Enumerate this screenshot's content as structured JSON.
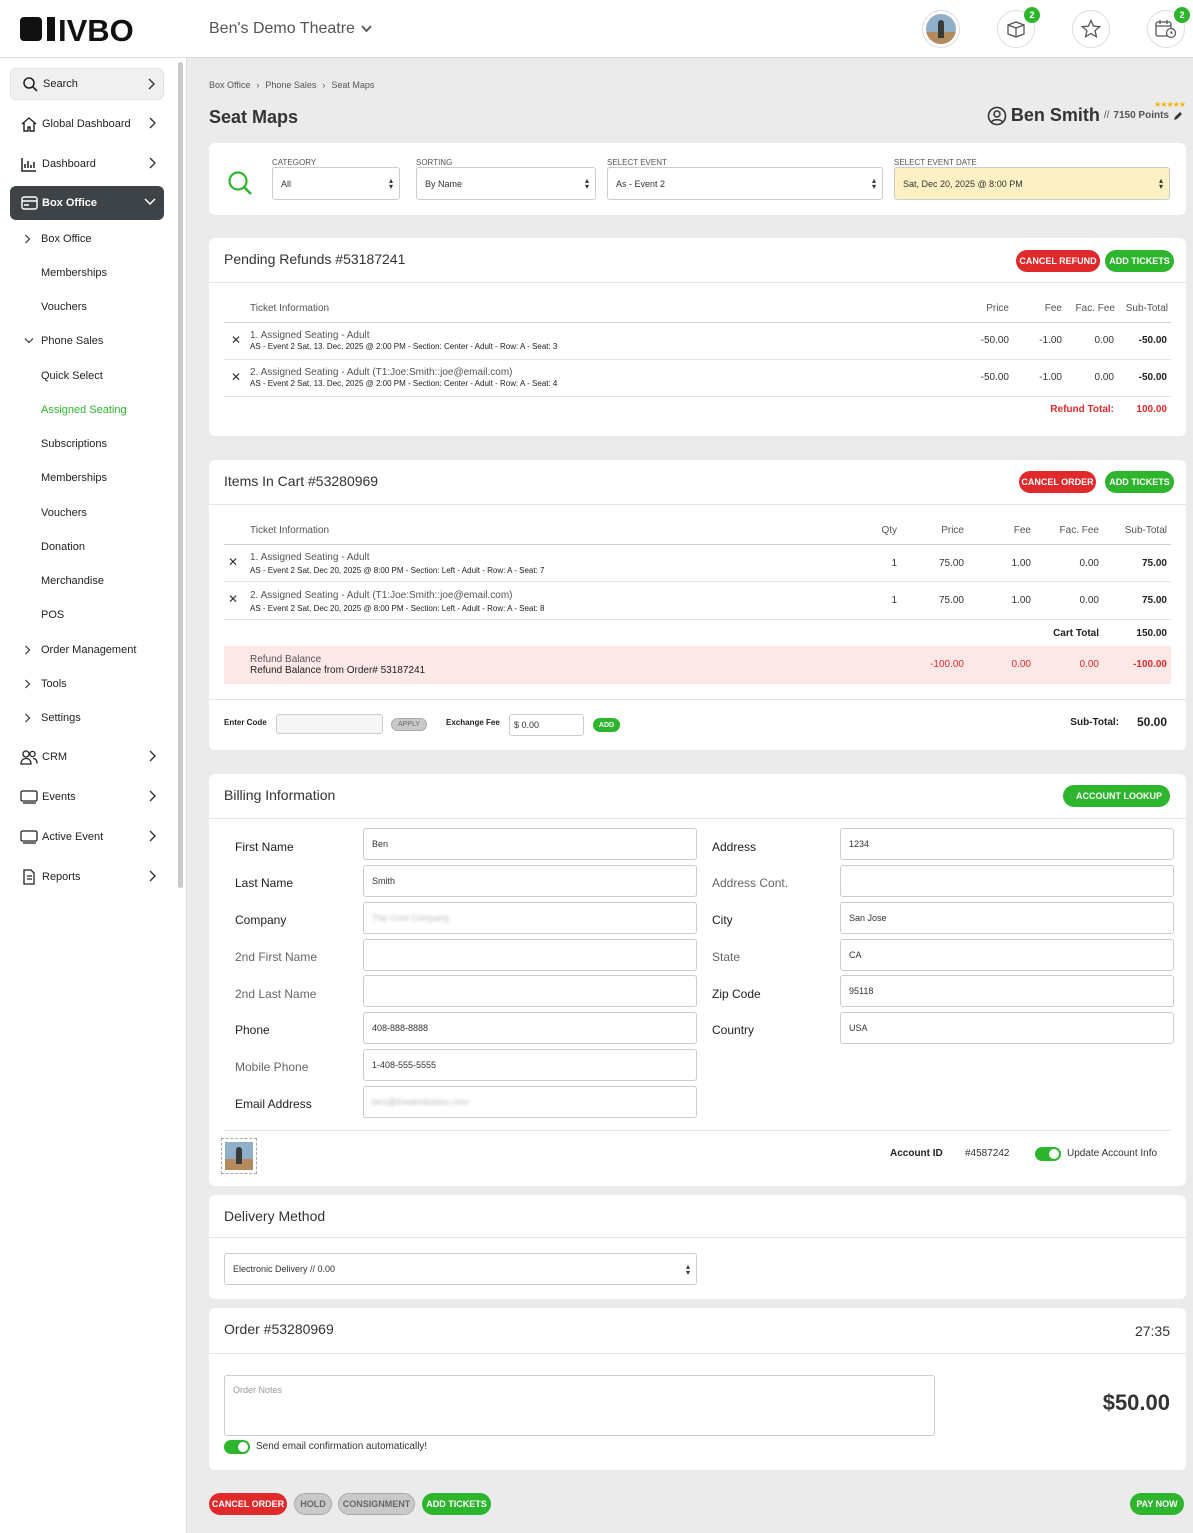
{
  "header": {
    "logo": "IVBO",
    "theatre": "Ben's Demo Theatre",
    "cart_badge": "2",
    "calendar_badge": "2",
    "icons": [
      "avatar",
      "box-icon",
      "star-icon",
      "calendar-icon"
    ]
  },
  "sidebar": {
    "main_items": [
      {
        "label": "Search",
        "icon": "search-icon"
      },
      {
        "label": "Global Dashboard",
        "icon": "home-icon"
      },
      {
        "label": "Dashboard",
        "icon": "chart-icon"
      },
      {
        "label": "Box Office",
        "icon": "card-icon"
      }
    ],
    "sub_items": [
      {
        "label": "Box Office"
      },
      {
        "label": "Memberships"
      },
      {
        "label": "Vouchers"
      },
      {
        "label": "Phone Sales"
      },
      {
        "label": "Quick Select"
      },
      {
        "label": "Assigned Seating"
      },
      {
        "label": "Subscriptions"
      },
      {
        "label": "Memberships"
      },
      {
        "label": "Vouchers"
      },
      {
        "label": "Donation"
      },
      {
        "label": "Merchandise"
      },
      {
        "label": "POS"
      },
      {
        "label": "Order Management"
      },
      {
        "label": "Tools"
      },
      {
        "label": "Settings"
      }
    ],
    "bottom_items": [
      {
        "label": "CRM",
        "icon": "people-icon"
      },
      {
        "label": "Events",
        "icon": "ticket-icon"
      },
      {
        "label": "Active Event",
        "icon": "ticket-icon"
      },
      {
        "label": "Reports",
        "icon": "document-icon"
      }
    ]
  },
  "breadcrumb": [
    "Box Office",
    "Phone Sales",
    "Seat Maps"
  ],
  "page_title": "Seat Maps",
  "user": {
    "name": "Ben Smith",
    "sep": "//",
    "points": "7150 Points",
    "stars": "★★★★★"
  },
  "filters": {
    "category_label": "CATEGORY",
    "category": "All",
    "sorting_label": "SORTING",
    "sorting": "By Name",
    "event_label": "SELECT EVENT",
    "event": "As - Event 2",
    "date_label": "SELECT EVENT DATE",
    "date": "Sat, Dec 20, 2025 @ 8:00 PM"
  },
  "refunds": {
    "title": "Pending Refunds #53187241",
    "cancel_btn": "CANCEL REFUND",
    "add_btn": "ADD TICKETS",
    "headers": {
      "info": "Ticket Information",
      "price": "Price",
      "fee": "Fee",
      "fac": "Fac. Fee",
      "sub": "Sub-Total"
    },
    "rows": [
      {
        "num": "1.",
        "title": "Assigned Seating - Adult",
        "desc": "AS - Event 2 Sat, 13. Dec, 2025 @ 2:00 PM - Section: Center - Adult - Row: A - Seat: 3",
        "price": "-50.00",
        "fee": "-1.00",
        "fac": "0.00",
        "sub": "-50.00"
      },
      {
        "num": "2.",
        "title": "Assigned Seating - Adult (T1:Joe:Smith::joe@email.com)",
        "desc": "AS - Event 2 Sat, 13. Dec, 2025 @ 2:00 PM - Section: Center - Adult - Row: A - Seat: 4",
        "price": "-50.00",
        "fee": "-1.00",
        "fac": "0.00",
        "sub": "-50.00"
      }
    ],
    "total_label": "Refund Total:",
    "total": "100.00"
  },
  "cart": {
    "title": "Items In Cart #53280969",
    "cancel_btn": "CANCEL ORDER",
    "add_btn": "ADD TICKETS",
    "headers": {
      "info": "Ticket Information",
      "qty": "Qty",
      "price": "Price",
      "fee": "Fee",
      "fac": "Fac. Fee",
      "sub": "Sub-Total"
    },
    "rows": [
      {
        "num": "1.",
        "title": "Assigned Seating - Adult",
        "desc": "AS - Event 2 Sat, Dec 20, 2025 @ 8:00 PM - Section: Left - Adult - Row: A - Seat: 7",
        "qty": "1",
        "price": "75.00",
        "fee": "1.00",
        "fac": "0.00",
        "sub": "75.00"
      },
      {
        "num": "2.",
        "title": "Assigned Seating - Adult (T1:Joe:Smith::joe@email.com)",
        "desc": "AS - Event 2 Sat, Dec 20, 2025 @ 8:00 PM - Section: Left - Adult - Row: A - Seat: 8",
        "qty": "1",
        "price": "75.00",
        "fee": "1.00",
        "fac": "0.00",
        "sub": "75.00"
      }
    ],
    "cart_total_label": "Cart Total",
    "cart_total": "150.00",
    "refund_label": "Refund Balance",
    "refund_desc": "Refund Balance from Order# 53187241",
    "refund_price": "-100.00",
    "refund_fee": "0.00",
    "refund_fac": "0.00",
    "refund_sub": "-100.00",
    "code_label": "Enter Code",
    "apply_btn": "APPLY",
    "exch_label": "Exchange Fee",
    "exch_value": "$ 0.00",
    "add_small": "ADD",
    "subtotal_label": "Sub-Total:",
    "subtotal": "50.00"
  },
  "billing": {
    "title": "Billing Information",
    "lookup_btn": "ACCOUNT LOOKUP",
    "left": [
      {
        "label": "First Name",
        "value": "Ben",
        "strong": true
      },
      {
        "label": "Last Name",
        "value": "Smith",
        "strong": true
      },
      {
        "label": "Company",
        "value": "The Cool Company",
        "strong": true,
        "blur": true
      },
      {
        "label": "2nd First Name",
        "value": "",
        "strong": false
      },
      {
        "label": "2nd Last Name",
        "value": "",
        "strong": false
      },
      {
        "label": "Phone",
        "value": "408-888-8888",
        "strong": true
      },
      {
        "label": "Mobile Phone",
        "value": "1-408-555-5555",
        "strong": false
      },
      {
        "label": "Email Address",
        "value": "ben@theatretickets.com",
        "strong": true,
        "blur": true
      }
    ],
    "right": [
      {
        "label": "Address",
        "value": "1234",
        "strong": true
      },
      {
        "label": "Address Cont.",
        "value": "",
        "strong": false
      },
      {
        "label": "City",
        "value": "San Jose",
        "strong": true
      },
      {
        "label": "State",
        "value": "CA",
        "strong": false
      },
      {
        "label": "Zip Code",
        "value": "95118",
        "strong": true
      },
      {
        "label": "Country",
        "value": "USA",
        "strong": true
      }
    ],
    "account_id_label": "Account ID",
    "account_id": "#4587242",
    "update_label": "Update Account Info"
  },
  "delivery": {
    "title": "Delivery Method",
    "value": "Electronic Delivery // 0.00"
  },
  "order": {
    "title": "Order #53280969",
    "timer": "27:35",
    "notes_placeholder": "Order Notes",
    "total": "$50.00",
    "email_label": "Send email confirmation automatically!"
  },
  "footer_buttons": {
    "cancel": "CANCEL ORDER",
    "hold": "HOLD",
    "consign": "CONSIGNMENT",
    "add": "ADD TICKETS",
    "pay": "PAY NOW"
  },
  "colors": {
    "green": "#2db52d",
    "red": "#e0292b",
    "dark": "#3d4347",
    "highlight": "#fdf0c4",
    "refund_bg": "#fde8e8"
  }
}
